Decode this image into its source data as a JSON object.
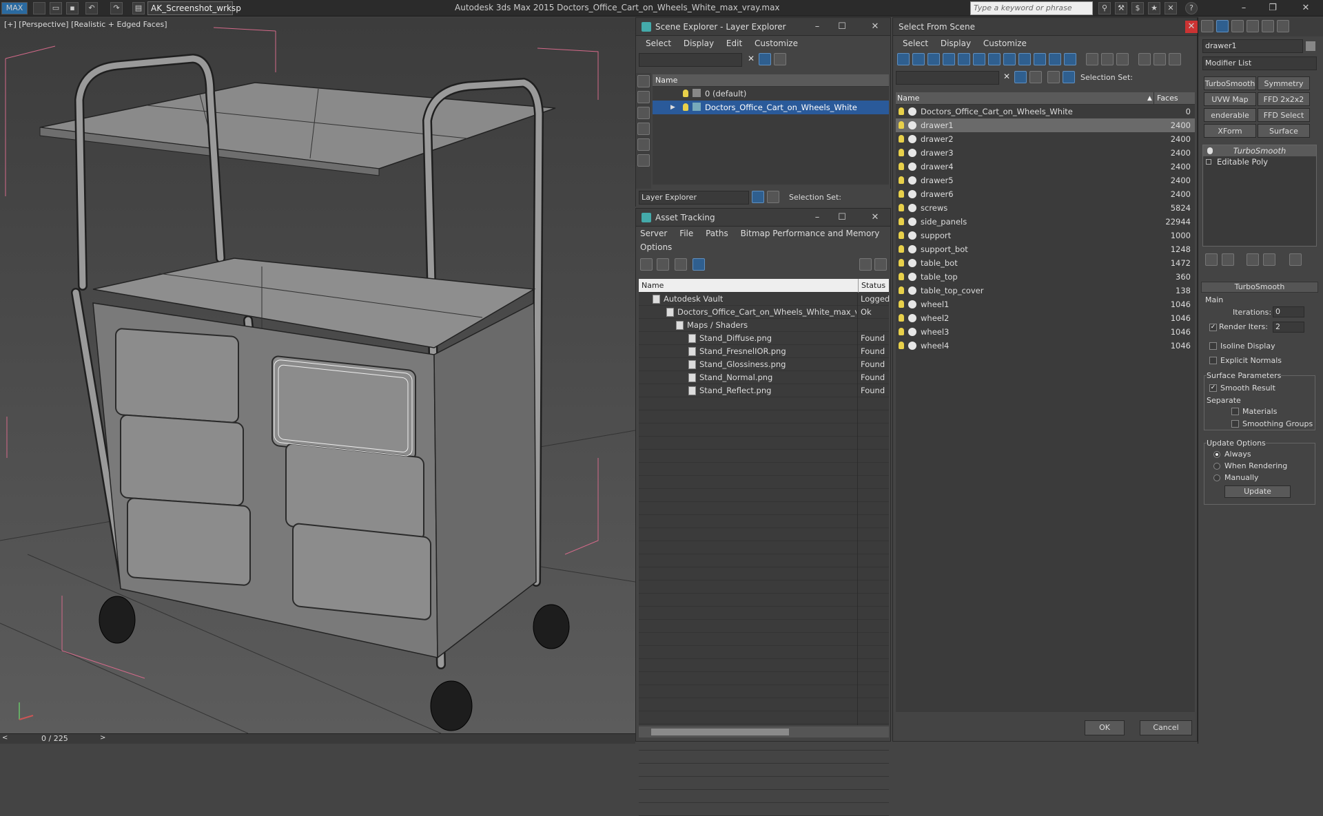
{
  "titlebar": {
    "workspace": "AK_Screenshot_wrksp",
    "title": "Autodesk 3ds Max  2015    Doctors_Office_Cart_on_Wheels_White_max_vray.max",
    "search_placeholder": "Type a keyword or phrase",
    "logo": "MAX"
  },
  "viewport": {
    "label": "[+] [Perspective] [Realistic + Edged Faces]",
    "time": "0 / 225"
  },
  "scene_explorer": {
    "title": "Scene Explorer - Layer Explorer",
    "menu": [
      "Select",
      "Display",
      "Edit",
      "Customize"
    ],
    "col_name": "Name",
    "layers": [
      "0 (default)",
      "Doctors_Office_Cart_on_Wheels_White"
    ],
    "footer_dropdown": "Layer Explorer",
    "selection_set_label": "Selection Set:"
  },
  "asset_tracking": {
    "title": "Asset Tracking",
    "menu": [
      "Server",
      "File",
      "Paths",
      "Bitmap Performance and Memory"
    ],
    "menu2": [
      "Options"
    ],
    "col_name": "Name",
    "col_status": "Status",
    "rows": [
      {
        "name": "Autodesk Vault",
        "status": "Logged"
      },
      {
        "name": "Doctors_Office_Cart_on_Wheels_White_max_vr...",
        "status": "Ok"
      },
      {
        "name": "Maps / Shaders",
        "status": ""
      },
      {
        "name": "Stand_Diffuse.png",
        "status": "Found"
      },
      {
        "name": "Stand_FresnelIOR.png",
        "status": "Found"
      },
      {
        "name": "Stand_Glossiness.png",
        "status": "Found"
      },
      {
        "name": "Stand_Normal.png",
        "status": "Found"
      },
      {
        "name": "Stand_Reflect.png",
        "status": "Found"
      }
    ]
  },
  "select_from_scene": {
    "title": "Select From Scene",
    "menu": [
      "Select",
      "Display",
      "Customize"
    ],
    "selection_set_label": "Selection Set:",
    "col_name": "Name",
    "col_faces": "Faces",
    "rows": [
      {
        "name": "Doctors_Office_Cart_on_Wheels_White",
        "faces": "0"
      },
      {
        "name": "drawer1",
        "faces": "2400"
      },
      {
        "name": "drawer2",
        "faces": "2400"
      },
      {
        "name": "drawer3",
        "faces": "2400"
      },
      {
        "name": "drawer4",
        "faces": "2400"
      },
      {
        "name": "drawer5",
        "faces": "2400"
      },
      {
        "name": "drawer6",
        "faces": "2400"
      },
      {
        "name": "screws",
        "faces": "5824"
      },
      {
        "name": "side_panels",
        "faces": "22944"
      },
      {
        "name": "support",
        "faces": "1000"
      },
      {
        "name": "support_bot",
        "faces": "1248"
      },
      {
        "name": "table_bot",
        "faces": "1472"
      },
      {
        "name": "table_top",
        "faces": "360"
      },
      {
        "name": "table_top_cover",
        "faces": "138"
      },
      {
        "name": "wheel1",
        "faces": "1046"
      },
      {
        "name": "wheel2",
        "faces": "1046"
      },
      {
        "name": "wheel3",
        "faces": "1046"
      },
      {
        "name": "wheel4",
        "faces": "1046"
      }
    ],
    "ok": "OK",
    "cancel": "Cancel"
  },
  "modify_panel": {
    "object_name": "drawer1",
    "modifier_list": "Modifier List",
    "buttons": [
      "TurboSmooth",
      "Symmetry",
      "UVW Map",
      "FFD 2x2x2",
      "enderable Spli",
      "FFD Select",
      "XForm",
      "Surface Select"
    ],
    "stack": [
      "TurboSmooth",
      "Editable Poly"
    ],
    "rollout_title": "TurboSmooth",
    "main_label": "Main",
    "iterations_label": "Iterations:",
    "iterations_value": "0",
    "render_iters_label": "Render Iters:",
    "render_iters_value": "2",
    "isoline": "Isoline Display",
    "explicit": "Explicit Normals",
    "surface_params": "Surface Parameters",
    "smooth_result": "Smooth Result",
    "separate": "Separate",
    "materials": "Materials",
    "smoothing_groups": "Smoothing Groups",
    "update_options": "Update Options",
    "always": "Always",
    "when_rendering": "When Rendering",
    "manually": "Manually",
    "update_btn": "Update"
  }
}
